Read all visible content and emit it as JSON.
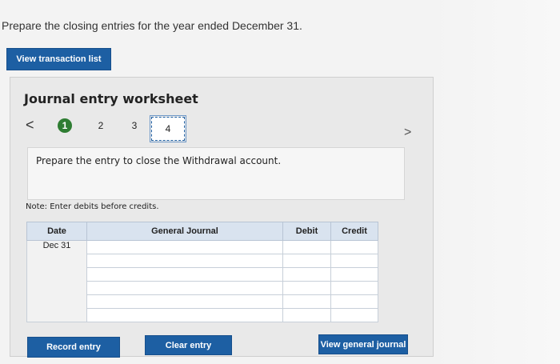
{
  "instruction": "Prepare the closing entries for the year ended December 31.",
  "buttons": {
    "view_transaction_list": "View transaction list",
    "record_entry": "Record entry",
    "clear_entry": "Clear entry",
    "view_general_journal": "View general journal"
  },
  "worksheet": {
    "title": "Journal entry worksheet",
    "nav": {
      "prev_symbol": "<",
      "next_symbol": ">",
      "steps": [
        "1",
        "2",
        "3",
        "4"
      ],
      "active_step": "1",
      "selected_step": "4"
    },
    "prompt": "Prepare the entry to close the Withdrawal account.",
    "note": "Note: Enter debits before credits."
  },
  "journal": {
    "headers": {
      "date": "Date",
      "general_journal": "General Journal",
      "debit": "Debit",
      "credit": "Credit"
    },
    "rows": [
      {
        "date": "Dec 31",
        "account": "",
        "debit": "",
        "credit": ""
      },
      {
        "date": "",
        "account": "",
        "debit": "",
        "credit": ""
      },
      {
        "date": "",
        "account": "",
        "debit": "",
        "credit": ""
      },
      {
        "date": "",
        "account": "",
        "debit": "",
        "credit": ""
      },
      {
        "date": "",
        "account": "",
        "debit": "",
        "credit": ""
      },
      {
        "date": "",
        "account": "",
        "debit": "",
        "credit": ""
      }
    ]
  },
  "colors": {
    "primary_button": "#1d5fa3",
    "active_step": "#2e7d32",
    "table_header": "#d9e3ef"
  }
}
